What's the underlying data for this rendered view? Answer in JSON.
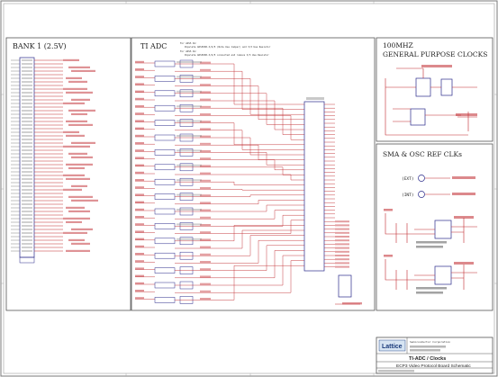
{
  "panels": {
    "bank1": {
      "title": "BANK 1 (2.5V)"
    },
    "ti_adc": {
      "title": "TI ADC",
      "notes": [
        "For ADS5 Rx:",
        "Populate ADS5000-3/4/5 (Note Use Jumper) and 3/3 Use Resistor",
        "For ADS5 Rx:",
        "Populate ADS5000-3/4/5 connected and remove 3/3 Use Resistor"
      ]
    },
    "gp_clocks": {
      "title_line1": "100MHZ",
      "title_line2": "GENERAL PURPOSE CLOCKS"
    },
    "sma_clk": {
      "title": "SMA & OSC REF CLKs",
      "ext_label": "(EXT)",
      "int_label": "(INT)"
    }
  },
  "title_block": {
    "company": "Lattice",
    "company_sub": "Semiconductor Corporation",
    "sheet_title": "TI-ADC / Clocks",
    "board_title": "ECP3 Video Protocol Board Schematic"
  },
  "colors": {
    "frame": "#606060",
    "wire": "#c0282d",
    "component": "#2a2a8a",
    "text": "#3a3a3a"
  }
}
